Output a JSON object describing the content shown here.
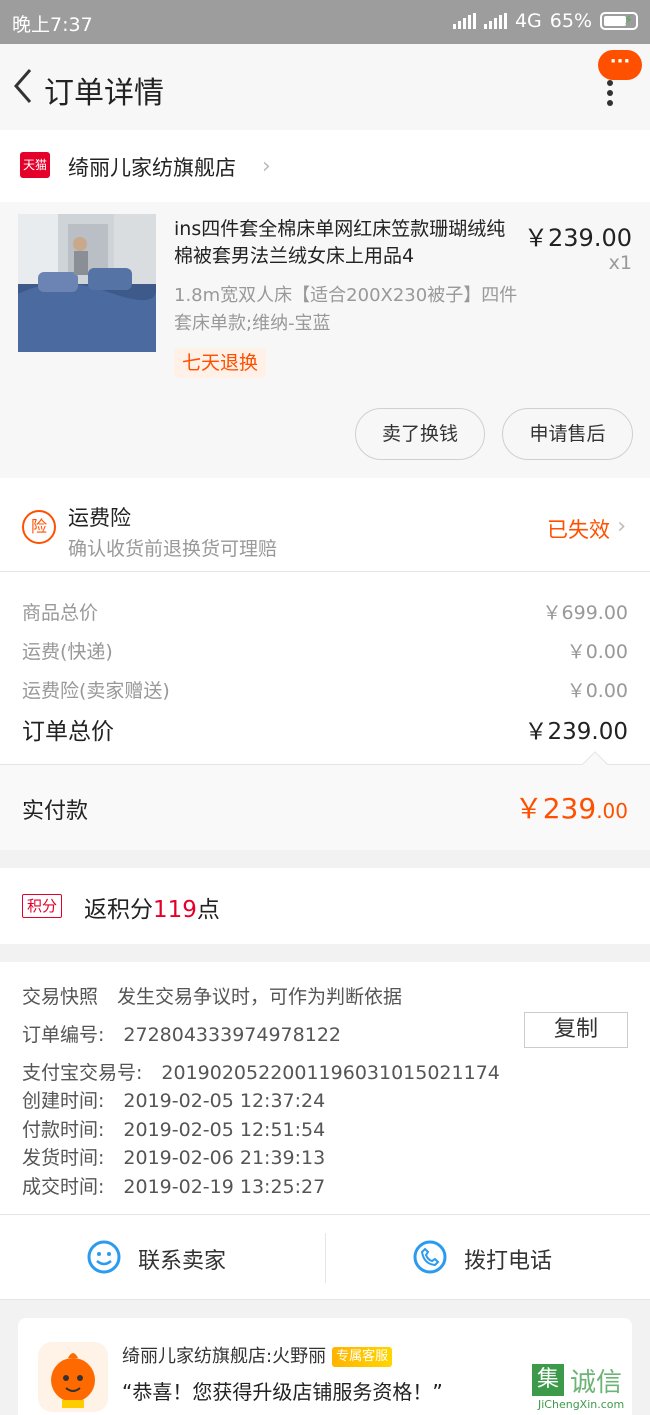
{
  "status_bar": {
    "time": "晚上7:37",
    "network": "4G",
    "battery": "65%"
  },
  "nav": {
    "title": "订单详情",
    "message_badge": "···"
  },
  "shop": {
    "logo_text": "天猫",
    "name": "绮丽儿家纺旗舰店"
  },
  "item": {
    "title": "ins四件套全棉床单网红床笠款珊瑚绒纯棉被套男法兰绒女床上用品4",
    "sku": "1.8m宽双人床【适合200X230被子】四件套床单款;维纳-宝蓝",
    "price": "￥239.00",
    "quantity": "x1",
    "return_tag": "七天退换",
    "btn_resell": "卖了换钱",
    "btn_aftersale": "申请售后"
  },
  "insurance": {
    "icon_text": "险",
    "title": "运费险",
    "subtitle": "确认收货前退换货可理赔",
    "status": "已失效"
  },
  "prices": {
    "goods_label": "商品总价",
    "goods_value": "￥699.00",
    "shipping_label": "运费(快递)",
    "shipping_value": "￥0.00",
    "ins_label": "运费险(卖家赠送)",
    "ins_value": "￥0.00",
    "total_label": "订单总价",
    "total_value": "￥239.00"
  },
  "paid": {
    "label": "实付款",
    "value_main": "￥239",
    "value_cents": ".00"
  },
  "points": {
    "badge": "积分",
    "prefix": "返积分",
    "number": "119",
    "suffix": "点"
  },
  "order_info": {
    "snapshot": "交易快照　发生交易争议时，可作为判断依据",
    "order_no": "订单编号:　272804333974978122",
    "copy_btn": "复制",
    "alipay_no": "支付宝交易号:　2019020522001196031015021174",
    "created": "创建时间:　2019-02-05 12:37:24",
    "paid": "付款时间:　2019-02-05 12:51:54",
    "shipped": "发货时间:　2019-02-06 21:39:13",
    "completed": "成交时间:　2019-02-19 13:25:27"
  },
  "contact": {
    "seller": "联系卖家",
    "phone": "拨打电话"
  },
  "cs": {
    "name": "绮丽儿家纺旗舰店:火野丽",
    "tag": "专属客服",
    "message": "“恭喜！您获得升级店铺服务资格！”"
  },
  "watermark": {
    "box_char": "集",
    "text": "诚信",
    "url": "JiChengXin.com"
  },
  "colors": {
    "accent": "#ff5000",
    "tmall_red": "#e4002b",
    "status_bar": "#9d9d9d"
  }
}
